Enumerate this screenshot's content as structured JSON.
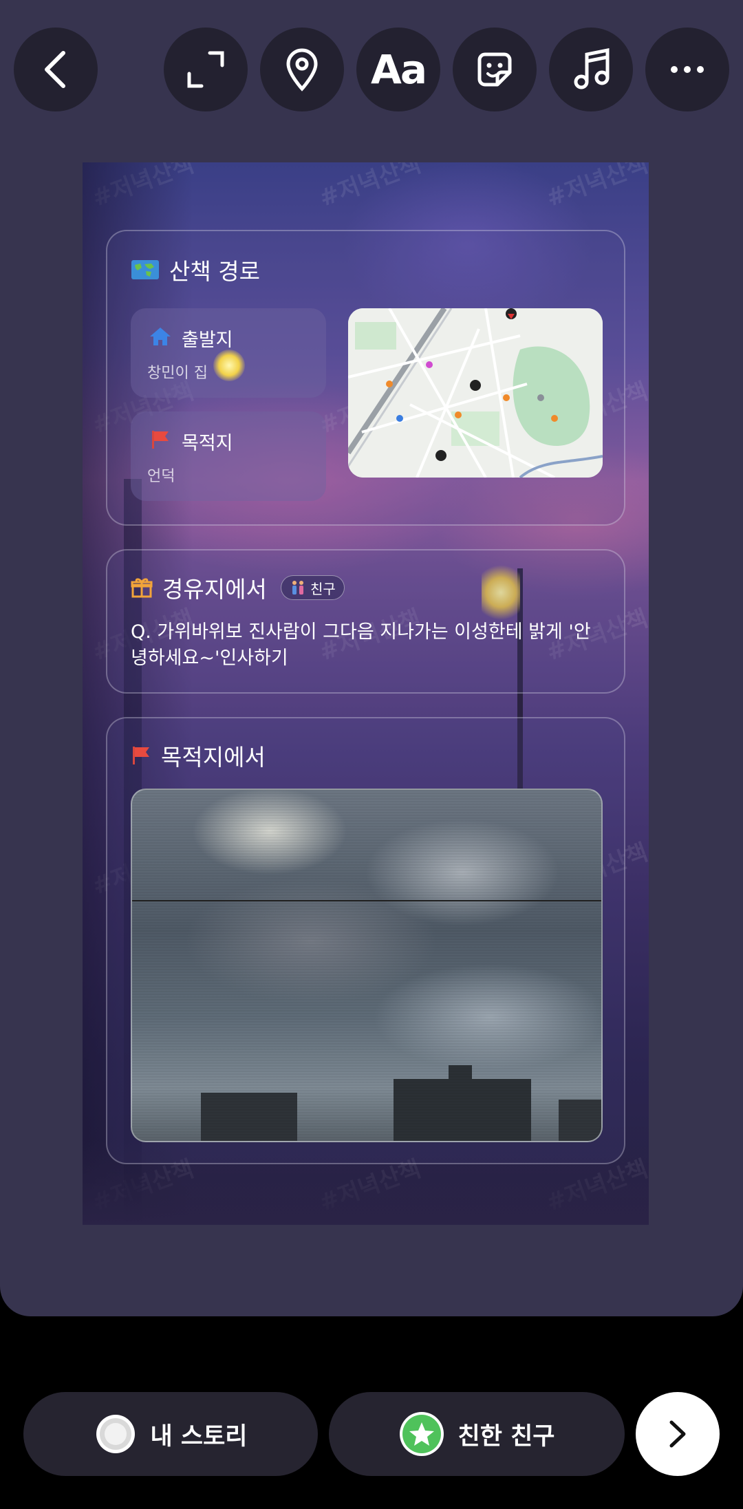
{
  "toolbar": {
    "back_icon": "chevron-left-icon",
    "expand_icon": "expand-icon",
    "location_icon": "location-pin-icon",
    "text_label": "Aa",
    "sticker_icon": "sticker-icon",
    "music_icon": "music-note-icon",
    "more_icon": "more-horizontal-icon"
  },
  "story": {
    "watermark": "#저녁산책",
    "route_card": {
      "title": "산책 경로",
      "start_label": "출발지",
      "start_value": "창민이 집",
      "dest_label": "목적지",
      "dest_value": "언덕"
    },
    "waypoint_card": {
      "title": "경유지에서",
      "badge": "친구",
      "question": "Q. 가위바위보 진사람이 그다음 지나가는 이성한테 밝게 '안녕하세요~'인사하기"
    },
    "destination_card": {
      "title": "목적지에서"
    }
  },
  "bottom": {
    "my_story_label": "내 스토리",
    "close_friends_label": "친한 친구",
    "next_icon": "chevron-right-icon"
  },
  "colors": {
    "stage_bg": "#37344f",
    "close_friends_green": "#4fc25b"
  }
}
